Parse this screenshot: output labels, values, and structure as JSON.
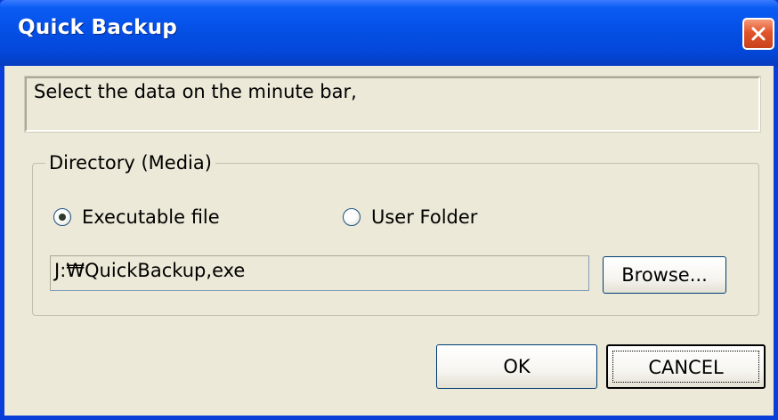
{
  "window": {
    "title": "Quick Backup",
    "close_icon": "close-icon"
  },
  "message": {
    "text": "Select the data on the minute bar,"
  },
  "directory_group": {
    "legend": "Directory (Media)",
    "options": [
      {
        "label": "Executable file",
        "selected": true
      },
      {
        "label": "User Folder",
        "selected": false
      }
    ],
    "path_value": "J:₩QuickBackup,exe",
    "browse_label": "Browse..."
  },
  "buttons": {
    "ok_label": "OK",
    "cancel_label": "CANCEL"
  },
  "colors": {
    "titlebar": "#0550e6",
    "client_bg": "#ece9d8",
    "close_button": "#e2552a"
  }
}
